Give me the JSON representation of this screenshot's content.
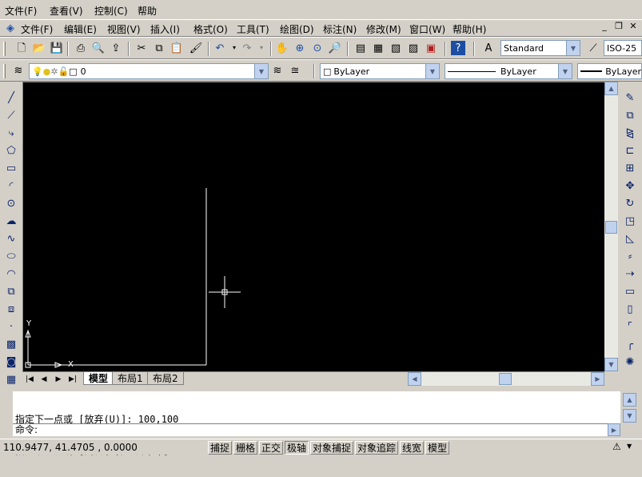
{
  "menu": [
    "文件(F)",
    "查看(V)",
    "控制(C)",
    "帮助"
  ],
  "inner_menu": [
    "文件(F)",
    "编辑(E)",
    "视图(V)",
    "插入(I)",
    "格式(O)",
    "工具(T)",
    "绘图(D)",
    "标注(N)",
    "修改(M)",
    "窗口(W)",
    "帮助(H)"
  ],
  "window_controls": [
    "_",
    "❐",
    "✕"
  ],
  "text_style": "Standard",
  "dim_style": "ISO-25",
  "layer": "0",
  "color": "ByLayer",
  "linetype": "ByLayer",
  "lineweight": "ByLayer",
  "ucs": {
    "y": "Y",
    "x": "X"
  },
  "tabs": [
    "模型",
    "布局1",
    "布局2"
  ],
  "command_history": [
    "指定下一点或 [放弃(U)]: 100,100",
    "指定下一点或 [闭合(C)/放弃(U)]:"
  ],
  "command_prompt": "命令:",
  "coordinates": "110.9477, 41.4705 , 0.0000",
  "status_buttons": [
    "捕捉",
    "栅格",
    "正交",
    "极轴",
    "对象捕捉",
    "对象追踪",
    "线宽",
    "模型"
  ],
  "status_on": [
    "极轴"
  ],
  "colors": {
    "canvas": "#000000",
    "chrome": "#d4d0c8",
    "drawing": "#ffffff"
  }
}
